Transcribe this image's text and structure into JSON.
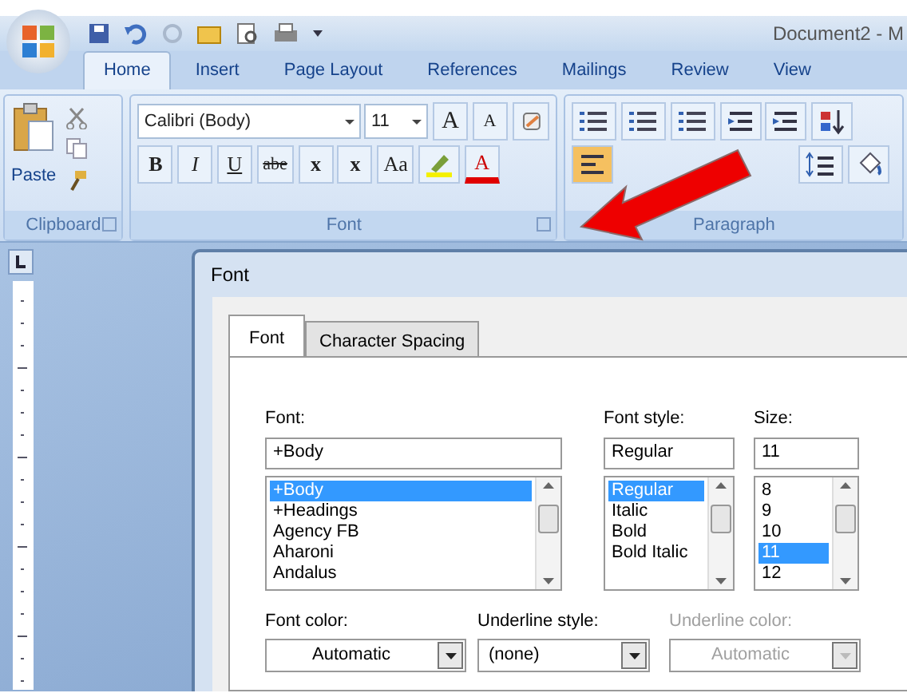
{
  "title_bar": {
    "title": "Document2 - M"
  },
  "ribbon_tabs": [
    {
      "label": "Home",
      "selected": true
    },
    {
      "label": "Insert",
      "selected": false
    },
    {
      "label": "Page Layout",
      "selected": false
    },
    {
      "label": "References",
      "selected": false
    },
    {
      "label": "Mailings",
      "selected": false
    },
    {
      "label": "Review",
      "selected": false
    },
    {
      "label": "View",
      "selected": false
    }
  ],
  "ribbon": {
    "paste_label": "Paste",
    "font_name": "Calibri (Body)",
    "font_size": "11",
    "grow_font": "A",
    "shrink_font": "A",
    "format_buttons": [
      {
        "label": "B",
        "kind": "bold"
      },
      {
        "label": "I",
        "kind": "italic"
      },
      {
        "label": "U",
        "kind": "underline"
      },
      {
        "label": "abe",
        "kind": "strike"
      },
      {
        "label": "x",
        "kind": "sub"
      },
      {
        "label": "x",
        "kind": "sup"
      },
      {
        "label": "Aa",
        "kind": "plain"
      }
    ],
    "font_color_label": "A",
    "groups": [
      "Clipboard",
      "Font",
      "Paragraph"
    ]
  },
  "dialog": {
    "title": "Font",
    "tabs": [
      {
        "label": "Font",
        "selected": true
      },
      {
        "label": "Character Spacing",
        "selected": false
      }
    ],
    "font": {
      "label": "Font:",
      "value": "+Body",
      "items": [
        {
          "label": "+Body",
          "selected": true
        },
        {
          "label": "+Headings",
          "selected": false
        },
        {
          "label": "Agency FB",
          "selected": false
        },
        {
          "label": "Aharoni",
          "selected": false
        },
        {
          "label": "Andalus",
          "selected": false
        }
      ]
    },
    "font_style": {
      "label": "Font style:",
      "value": "Regular",
      "items": [
        {
          "label": "Regular",
          "selected": true
        },
        {
          "label": "Italic",
          "selected": false
        },
        {
          "label": "Bold",
          "selected": false
        },
        {
          "label": "Bold Italic",
          "selected": false
        }
      ]
    },
    "size": {
      "label": "Size:",
      "value": "11",
      "items": [
        {
          "label": "8",
          "selected": false
        },
        {
          "label": "9",
          "selected": false
        },
        {
          "label": "10",
          "selected": false
        },
        {
          "label": "11",
          "selected": true
        },
        {
          "label": "12",
          "selected": false
        }
      ]
    },
    "combos": [
      {
        "label": "Font color:",
        "value": "Automatic",
        "disabled": false,
        "kind": "color"
      },
      {
        "label": "Underline style:",
        "value": "(none)",
        "disabled": false,
        "kind": "list"
      },
      {
        "label": "Underline color:",
        "value": "Automatic",
        "disabled": true,
        "kind": "color"
      }
    ]
  }
}
